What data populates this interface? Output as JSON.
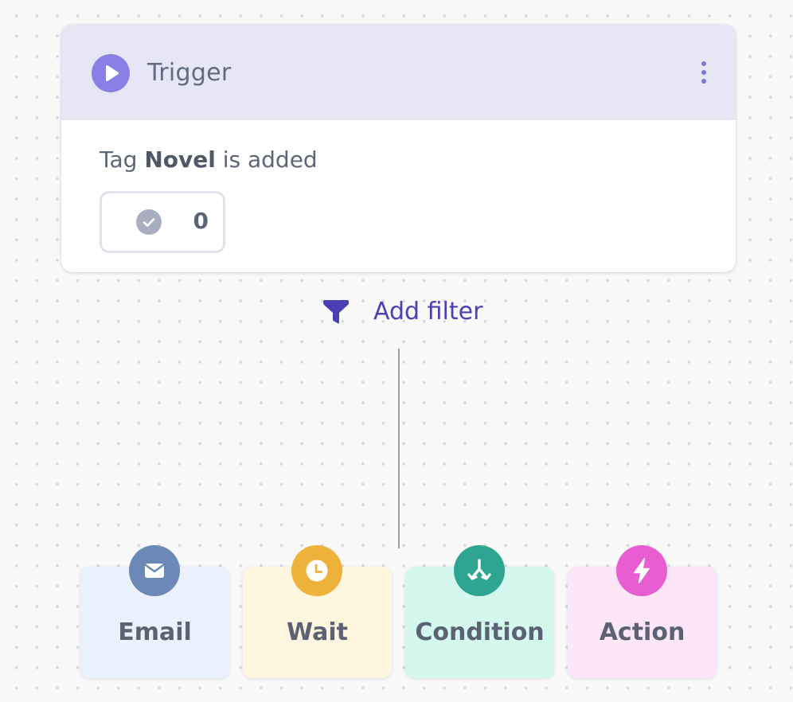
{
  "trigger": {
    "title": "Trigger",
    "description": {
      "prefix": "Tag",
      "tag_name": "Novel",
      "suffix": "is added"
    },
    "completed_count": "0",
    "icons": {
      "main": "play-icon",
      "menu": "kebab-menu-icon",
      "count": "check-circle-icon"
    }
  },
  "filter": {
    "label": "Add filter",
    "icon": "filter-funnel-icon"
  },
  "steps": [
    {
      "label": "Email",
      "icon": "envelope-icon",
      "bg_color": "#ecf2fd",
      "icon_color": "#6b88b6"
    },
    {
      "label": "Wait",
      "icon": "clock-icon",
      "bg_color": "#fff6e0",
      "icon_color": "#eeb13a"
    },
    {
      "label": "Condition",
      "icon": "branch-icon",
      "bg_color": "#d4f7ee",
      "icon_color": "#2da590"
    },
    {
      "label": "Action",
      "icon": "lightning-icon",
      "bg_color": "#fce6f8",
      "icon_color": "#e85ed2"
    }
  ],
  "colors": {
    "accent": "#4a3fb4",
    "trigger_header": "#e7e6f4",
    "trigger_icon": "#8b7fe6"
  }
}
